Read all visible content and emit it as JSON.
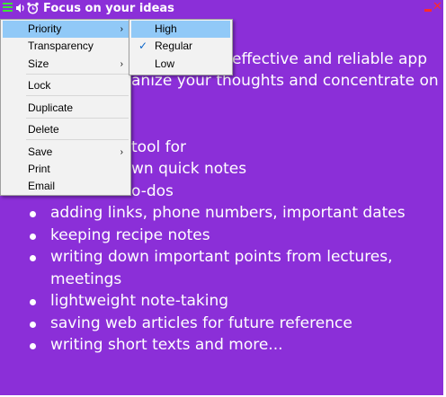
{
  "window": {
    "title": "Focus on your ideas",
    "icons": [
      "menu-icon",
      "speaker-icon",
      "alarm-clock-icon",
      "minimize-icon",
      "close-icon"
    ],
    "colors": {
      "note_background": "#8b2fd8",
      "text": "#ffffff",
      "accent_green": "#3ee23a",
      "window_controls": "#ff2a2a"
    }
  },
  "note": {
    "paragraph_lines": [
      "effective and reliable app",
      "anize your thoughts and concentrate on"
    ],
    "tool_for": "tool for",
    "bullets": [
      "wn quick notes",
      "o-dos",
      "adding links, phone numbers, important dates",
      "keeping recipe notes",
      "writing down important points from lectures, meetings",
      "lightweight note-taking",
      "saving web articles for future reference",
      "writing short texts and more..."
    ]
  },
  "context_menu": {
    "items": [
      {
        "label": "Priority",
        "has_submenu": true,
        "highlighted": true
      },
      {
        "label": "Transparency"
      },
      {
        "label": "Size",
        "has_submenu": true
      },
      {
        "label": "Lock"
      },
      {
        "label": "Duplicate"
      },
      {
        "label": "Delete"
      },
      {
        "label": "Save",
        "has_submenu": true
      },
      {
        "label": "Print"
      },
      {
        "label": "Email"
      }
    ],
    "submenu_arrow": "›",
    "colors": {
      "background": "#f2f2f2",
      "highlight": "#91c9f7"
    }
  },
  "priority_submenu": {
    "items": [
      {
        "label": "High",
        "highlighted": true
      },
      {
        "label": "Regular",
        "checked": true
      },
      {
        "label": "Low"
      }
    ],
    "check_mark": "✓"
  }
}
